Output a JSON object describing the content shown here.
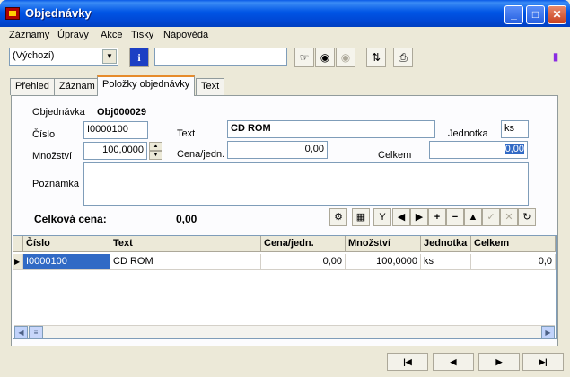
{
  "window": {
    "title": "Objednávky"
  },
  "caption_buttons": {
    "minimize": "_",
    "maximize": "□",
    "close": "✕"
  },
  "menu": [
    "Záznamy",
    "Úpravy",
    "Akce",
    "Tisky",
    "Nápověda"
  ],
  "toolbar": {
    "view_select": "(Výchozí)",
    "search_value": ""
  },
  "tabs": [
    "Přehled",
    "Záznam",
    "Položky objednávky",
    "Text"
  ],
  "active_tab": "Položky objednávky",
  "form": {
    "objednavka_label": "Objednávka",
    "objednavka_value": "Obj000029",
    "cislo_label": "Číslo",
    "cislo_value": "I0000100",
    "text_label": "Text",
    "text_value": "CD ROM",
    "jednotka_label": "Jednotka",
    "jednotka_value": "ks",
    "mnozstvi_label": "Množství",
    "mnozstvi_value": "100,0000",
    "cena_label": "Cena/jedn.",
    "cena_value": "0,00",
    "celkem_label": "Celkem",
    "celkem_value": "0,00",
    "poznamka_label": "Poznámka",
    "poznamka_value": "",
    "total_label": "Celková cena:",
    "total_value": "0,00"
  },
  "grid": {
    "columns": [
      "Číslo",
      "Text",
      "Cena/jedn.",
      "Množství",
      "Jednotka",
      "Celkem"
    ],
    "rows": [
      {
        "cislo": "I0000100",
        "text": "CD ROM",
        "cena": "0,00",
        "mnozstvi": "100,0000",
        "jednotka": "ks",
        "celkem": "0,0"
      }
    ]
  },
  "colors": {
    "titlebar": "#0055e5",
    "selection": "#316ac5",
    "active_tab_accent": "#e68b2c"
  }
}
